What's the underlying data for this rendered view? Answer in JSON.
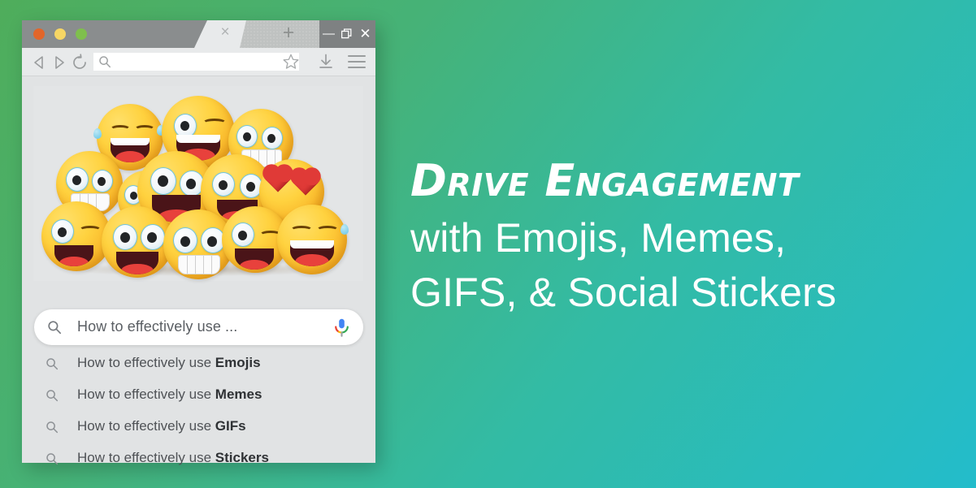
{
  "background": {
    "gradient_from": "#4FAD5B",
    "gradient_to": "#23BCCB"
  },
  "browser": {
    "titlebar": {
      "traffic_lights": [
        {
          "name": "close-dot",
          "color": "#E2662A"
        },
        {
          "name": "minimize-dot",
          "color": "#F6D664"
        },
        {
          "name": "zoom-dot",
          "color": "#7FBF4D"
        }
      ],
      "tab_close_label": "×",
      "new_tab_label": "+",
      "window_minimize_label": "—",
      "window_close_label": "✕"
    },
    "toolbar": {
      "back_icon": "back-triangle-icon",
      "forward_icon": "forward-triangle-icon",
      "reload_icon": "reload-icon",
      "url_value": "",
      "url_placeholder": "",
      "bookmark_icon": "star-icon",
      "download_icon": "download-icon",
      "menu_icon": "hamburger-menu-icon"
    },
    "page": {
      "hero_image_alt": "pile of smiling emoji faces",
      "search": {
        "value": "How to effectively use ...",
        "search_icon": "search-icon",
        "mic_icon": "microphone-icon"
      },
      "suggestions": [
        {
          "prefix": "How to effectively use ",
          "bold": "Emojis"
        },
        {
          "prefix": "How to effectively use ",
          "bold": "Memes"
        },
        {
          "prefix": "How to effectively use ",
          "bold": "GIFs"
        },
        {
          "prefix": "How to effectively use ",
          "bold": "Stickers"
        }
      ]
    }
  },
  "copy": {
    "headline": "Drive Engagement",
    "subline_1": "with Emojis, Memes,",
    "subline_2": "GIFS, & Social Stickers"
  }
}
